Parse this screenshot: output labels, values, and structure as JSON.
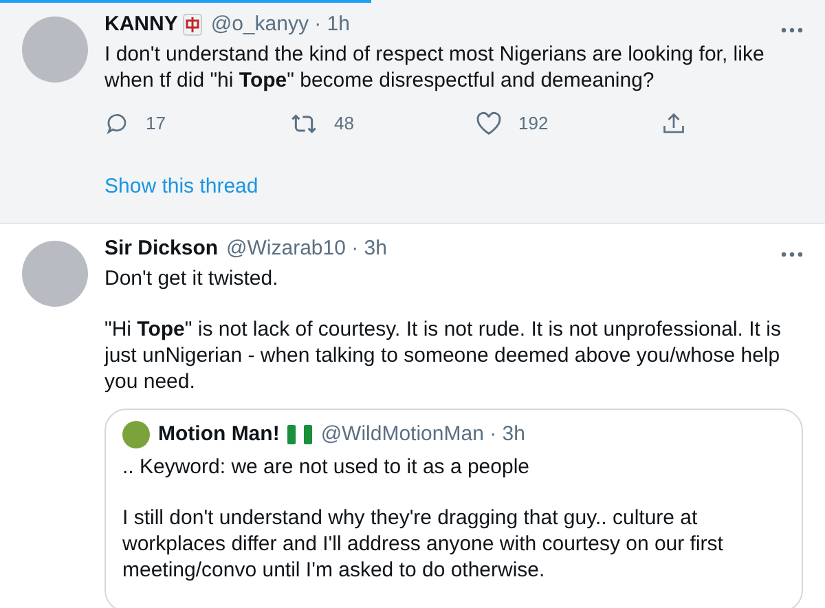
{
  "tweets": [
    {
      "name": "KANNY",
      "name_badge": true,
      "handle": "@o_kanyy · 1h",
      "highlighted": true,
      "paragraphs": [
        "I don't understand the kind of respect most Nigerians are looking for, like when tf did \"hi **Tope**\" become disrespectful and demeaning?"
      ],
      "actions": {
        "replies": "17",
        "retweets": "48",
        "likes": "192"
      },
      "show_thread": "Show this thread"
    },
    {
      "name": "Sir Dickson",
      "handle": "@Wizarab10 · 3h",
      "highlighted": false,
      "paragraphs": [
        "Don't get it twisted.",
        "\"Hi **Tope**\" is not lack of courtesy. It is not rude. It is not unprofessional. It is just unNigerian - when talking to someone deemed above you/whose help you need."
      ],
      "quote": {
        "name": "Motion Man!",
        "handle": "@WildMotionMan · 3h",
        "paragraphs": [
          ".. Keyword: we are not used to it as a people",
          "I still don't understand why they're dragging that guy.. culture at workplaces differ and I'll address anyone with courtesy on our first meeting/convo until I'm asked to do otherwise."
        ]
      }
    }
  ]
}
